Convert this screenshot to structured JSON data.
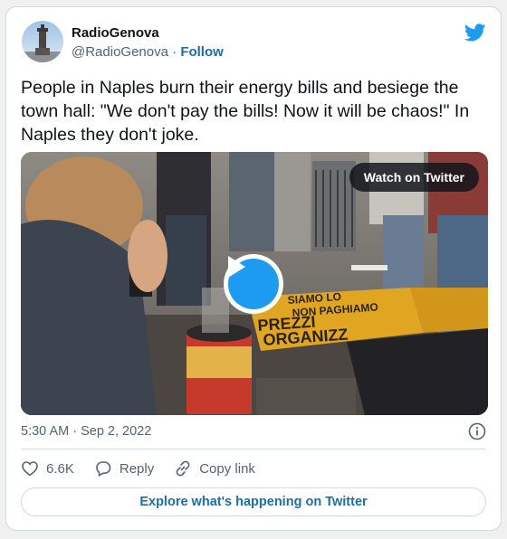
{
  "author": {
    "name": "RadioGenova",
    "handle": "@RadioGenova",
    "separator": "·",
    "follow_label": "Follow"
  },
  "tweet": {
    "text": "People in Naples burn their energy bills and besiege the town hall: \"We don't pay the bills! Now it will be chaos!\" In Naples they don't joke.",
    "timestamp": "5:30 AM · Sep 2, 2022"
  },
  "media": {
    "watch_label": "Watch on Twitter",
    "banner_lines": [
      "SIAMO LO",
      "NON PAGHIAMO",
      "PREZZI",
      "ORGANIZZ"
    ]
  },
  "actions": {
    "likes_count": "6.6K",
    "reply_label": "Reply",
    "copy_link_label": "Copy link"
  },
  "footer": {
    "explore_label": "Explore what's happening on Twitter"
  },
  "colors": {
    "brand_blue": "#1d9bf0",
    "link_blue": "#1d6ea3",
    "muted_text": "#536471",
    "border": "#cfd9de"
  },
  "icons": [
    "twitter-bird-icon",
    "play-icon",
    "info-icon",
    "heart-icon",
    "reply-icon",
    "link-icon"
  ]
}
